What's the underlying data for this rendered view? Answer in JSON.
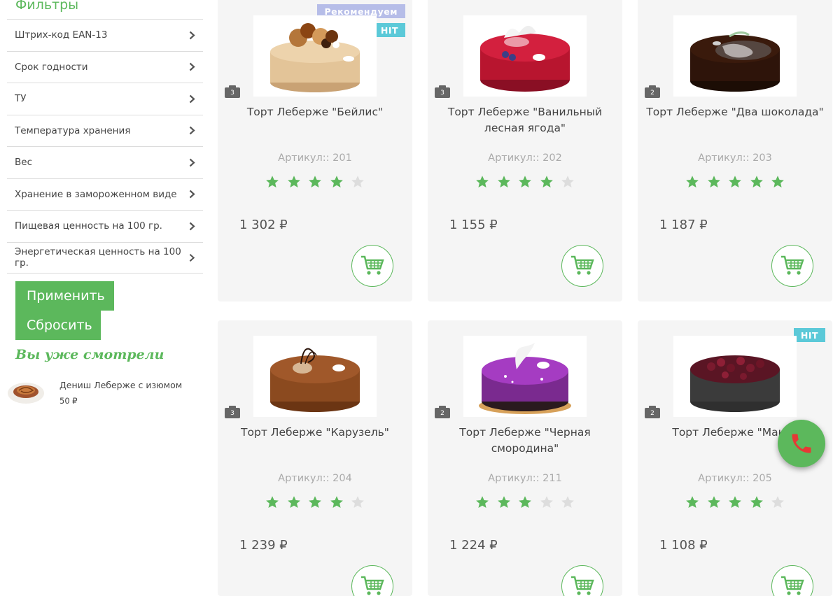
{
  "sidebar": {
    "filters_title": "Фильтры",
    "filters": [
      {
        "label": "Штрих-код EAN-13"
      },
      {
        "label": "Срок годности"
      },
      {
        "label": "ТУ"
      },
      {
        "label": "Температура хранения"
      },
      {
        "label": "Вес"
      },
      {
        "label": "Хранение в замороженном виде"
      },
      {
        "label": "Пищевая ценность на 100 гр."
      },
      {
        "label": "Энергетическая ценность на 100 гр."
      }
    ],
    "apply_label": "Применить",
    "reset_label": "Сбросить",
    "seen_title": "Вы уже смотрели",
    "seen_item": {
      "name": "Дениш Леберже с изюмом",
      "price": "50 ₽"
    }
  },
  "products": [
    {
      "title": "Торт Леберже \"Бейлис\"",
      "sku": "Артикул:: 201",
      "rating": 4,
      "price": "1 302 ₽",
      "photos": "3",
      "badge_recommend": "Рекомендуем",
      "badge_hit": "HIT"
    },
    {
      "title": "Торт Леберже \"Ванильный лесная ягода\"",
      "sku": "Артикул:: 202",
      "rating": 4,
      "price": "1 155 ₽",
      "photos": "3"
    },
    {
      "title": "Торт Леберже \"Два шоколада\"",
      "sku": "Артикул:: 203",
      "rating": 5,
      "price": "1 187 ₽",
      "photos": "2"
    },
    {
      "title": "Торт Леберже \"Карузель\"",
      "sku": "Артикул:: 204",
      "rating": 4,
      "price": "1 239 ₽",
      "photos": "3"
    },
    {
      "title": "Торт Леберже \"Черная смородина\"",
      "sku": "Артикул:: 211",
      "rating": 3,
      "price": "1 224 ₽",
      "photos": "2"
    },
    {
      "title": "Торт Леберже \"Маков",
      "sku": "Артикул:: 205",
      "rating": 4,
      "price": "1 108 ₽",
      "photos": "2",
      "badge_hit": "HIT"
    }
  ],
  "colors": {
    "accent": "#5cb85c",
    "star_on": "#5cb85c",
    "star_off": "#dddddd",
    "badge_recommend": "#b6bde8",
    "badge_hit": "#5bc9d8",
    "phone_icon": "#e53935"
  },
  "icons": {
    "filter_chevron": "chevron-right-icon",
    "photo_count": "camera-icon",
    "cart": "cart-icon",
    "call": "phone-icon",
    "rating": "star-icon"
  }
}
